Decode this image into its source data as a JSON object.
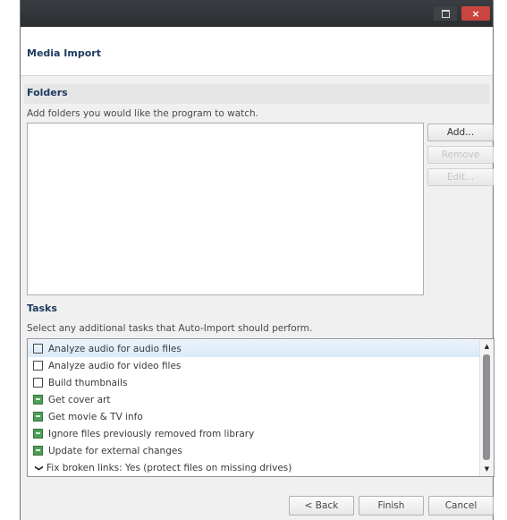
{
  "window": {
    "controls": {
      "close_glyph": "×"
    }
  },
  "header": {
    "title": "Media Import"
  },
  "folders": {
    "title": "Folders",
    "description": "Add folders you would like the program to watch.",
    "buttons": {
      "add": "Add...",
      "remove": "Remove",
      "edit": "Edit..."
    }
  },
  "tasks": {
    "title": "Tasks",
    "description": "Select any additional tasks that Auto-Import should perform.",
    "items": [
      {
        "label": "Analyze audio for audio files",
        "checked": false,
        "selected": true,
        "kind": "checkbox"
      },
      {
        "label": "Analyze audio for video files",
        "checked": false,
        "selected": false,
        "kind": "checkbox"
      },
      {
        "label": "Build thumbnails",
        "checked": false,
        "selected": false,
        "kind": "checkbox"
      },
      {
        "label": "Get cover art",
        "checked": true,
        "selected": false,
        "kind": "checkbox"
      },
      {
        "label": "Get movie & TV info",
        "checked": true,
        "selected": false,
        "kind": "checkbox"
      },
      {
        "label": "Ignore files previously removed from library",
        "checked": true,
        "selected": false,
        "kind": "checkbox"
      },
      {
        "label": "Update for external changes",
        "checked": true,
        "selected": false,
        "kind": "checkbox"
      },
      {
        "label": "Fix broken links: Yes (protect files on missing drives)",
        "checked": false,
        "selected": false,
        "kind": "expander"
      }
    ],
    "scroll_up_glyph": "▲",
    "scroll_down_glyph": "▼",
    "expander_glyph": "❯"
  },
  "footer": {
    "back": "< Back",
    "finish": "Finish",
    "cancel": "Cancel"
  },
  "colors": {
    "titlebar": "#2b2d31",
    "close_button": "#c9453d",
    "section_title": "#1f3b60",
    "checked_box": "#4aa155",
    "selection": "#dbeaf7"
  }
}
